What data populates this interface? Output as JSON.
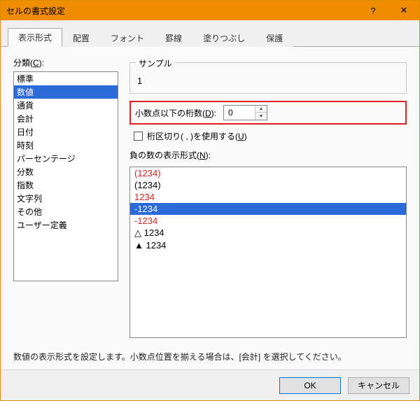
{
  "window": {
    "title": "セルの書式設定"
  },
  "tabs": [
    {
      "label": "表示形式"
    },
    {
      "label": "配置"
    },
    {
      "label": "フォント"
    },
    {
      "label": "罫線"
    },
    {
      "label": "塗りつぶし"
    },
    {
      "label": "保護"
    }
  ],
  "active_tab_index": 0,
  "category": {
    "label_prefix": "分類(",
    "label_key": "C",
    "label_suffix": "):",
    "items": [
      "標準",
      "数値",
      "通貨",
      "会計",
      "日付",
      "時刻",
      "パーセンテージ",
      "分数",
      "指数",
      "文字列",
      "その他",
      "ユーザー定義"
    ],
    "selected_index": 1
  },
  "sample": {
    "legend": "サンプル",
    "value": "1"
  },
  "decimals": {
    "label_prefix": "小数点以下の桁数(",
    "label_key": "D",
    "label_suffix": "):",
    "value": "0"
  },
  "thousands": {
    "label_prefix": "桁区切り( , )を使用する(",
    "label_key": "U",
    "label_suffix": ")",
    "checked": false
  },
  "negative": {
    "label_prefix": "負の数の表示形式(",
    "label_key": "N",
    "label_suffix": "):",
    "items": [
      {
        "text": "(1234)",
        "color": "#d22"
      },
      {
        "text": "(1234)",
        "color": "#000"
      },
      {
        "text": "1234",
        "color": "#d22"
      },
      {
        "text": "-1234",
        "color": "#000"
      },
      {
        "text": "-1234",
        "color": "#d22"
      },
      {
        "text": "△ 1234",
        "color": "#000"
      },
      {
        "text": "▲ 1234",
        "color": "#000"
      }
    ],
    "selected_index": 3
  },
  "description": "数値の表示形式を設定します。小数点位置を揃える場合は、[会計] を選択してください。",
  "buttons": {
    "ok": "OK",
    "cancel": "キャンセル"
  },
  "icons": {
    "help": "?",
    "close": "✕",
    "spin_up": "▲",
    "spin_down": "▼"
  }
}
